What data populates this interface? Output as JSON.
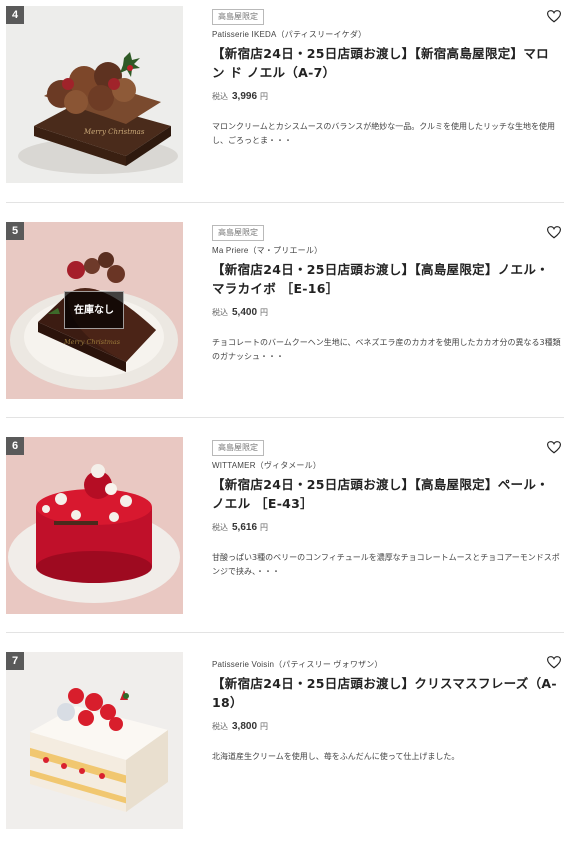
{
  "products": [
    {
      "rank": "4",
      "badge": "高島屋限定",
      "shop": "Patisserie IKEDA（パティスリーイケダ）",
      "title": "【新宿店24日・25日店頭お渡し】【新宿高島屋限定】マロン ド ノエル（A-7）",
      "tax_label": "税込",
      "price": "3,996",
      "yen": "円",
      "desc": "マロンクリームとカシスムースのバランスが絶妙な一品。クルミを使用したリッチな生地を使用し、ごろっとま・・・",
      "soldout": null
    },
    {
      "rank": "5",
      "badge": "高島屋限定",
      "shop": "Ma Priere（マ・プリエール）",
      "title": "【新宿店24日・25日店頭お渡し】【高島屋限定】ノエル・マラカイボ ［E-16］",
      "tax_label": "税込",
      "price": "5,400",
      "yen": "円",
      "desc": "チョコレートのバームクーヘン生地に、ベネズエラ産のカカオを使用したカカオ分の異なる3種類のガナッシュ・・・",
      "soldout": "在庫なし"
    },
    {
      "rank": "6",
      "badge": "高島屋限定",
      "shop": "WITTAMER（ヴィタメール）",
      "title": "【新宿店24日・25日店頭お渡し】【高島屋限定】ペール・ノエル ［E-43］",
      "tax_label": "税込",
      "price": "5,616",
      "yen": "円",
      "desc": "甘酸っぱい3種のベリーのコンフィチュールを濃厚なチョコレートムースとチョコアーモンドスポンジで挟み、・・・",
      "soldout": null
    },
    {
      "rank": "7",
      "badge": null,
      "shop": "Patisserie Voisin（パティスリー ヴォワザン）",
      "title": "【新宿店24日・25日店頭お渡し】クリスマスフレーズ（A-18）",
      "tax_label": "税込",
      "price": "3,800",
      "yen": "円",
      "desc": "北海道産生クリームを使用し、苺をふんだんに使って仕上げました。",
      "soldout": null
    }
  ],
  "icons": {
    "favorite": "heart-outline-icon"
  },
  "colors": {
    "rank_bg": "#5a5a5a",
    "divider": "#e3e3e3"
  }
}
